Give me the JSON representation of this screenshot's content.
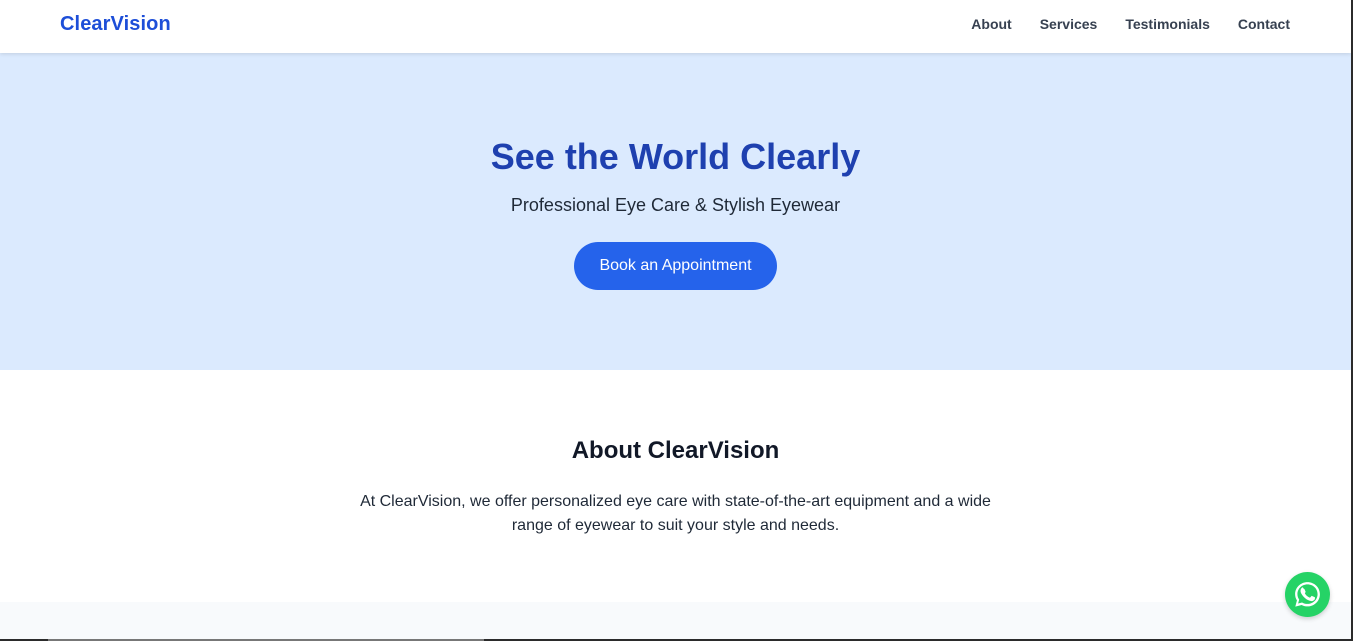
{
  "header": {
    "brand": "ClearVision",
    "nav": [
      {
        "label": "About"
      },
      {
        "label": "Services"
      },
      {
        "label": "Testimonials"
      },
      {
        "label": "Contact"
      }
    ]
  },
  "hero": {
    "title": "See the World Clearly",
    "subtitle": "Professional Eye Care & Stylish Eyewear",
    "button": "Book an Appointment"
  },
  "about": {
    "title": "About ClearVision",
    "text": "At ClearVision, we offer personalized eye care with state-of-the-art equipment and a wide range of eyewear to suit your style and needs."
  },
  "floating_action": {
    "icon": "whatsapp-icon"
  },
  "colors": {
    "brand": "#1d4ed8",
    "hero_background": "#dbeafe",
    "button": "#2563eb",
    "whatsapp": "#25d366"
  }
}
